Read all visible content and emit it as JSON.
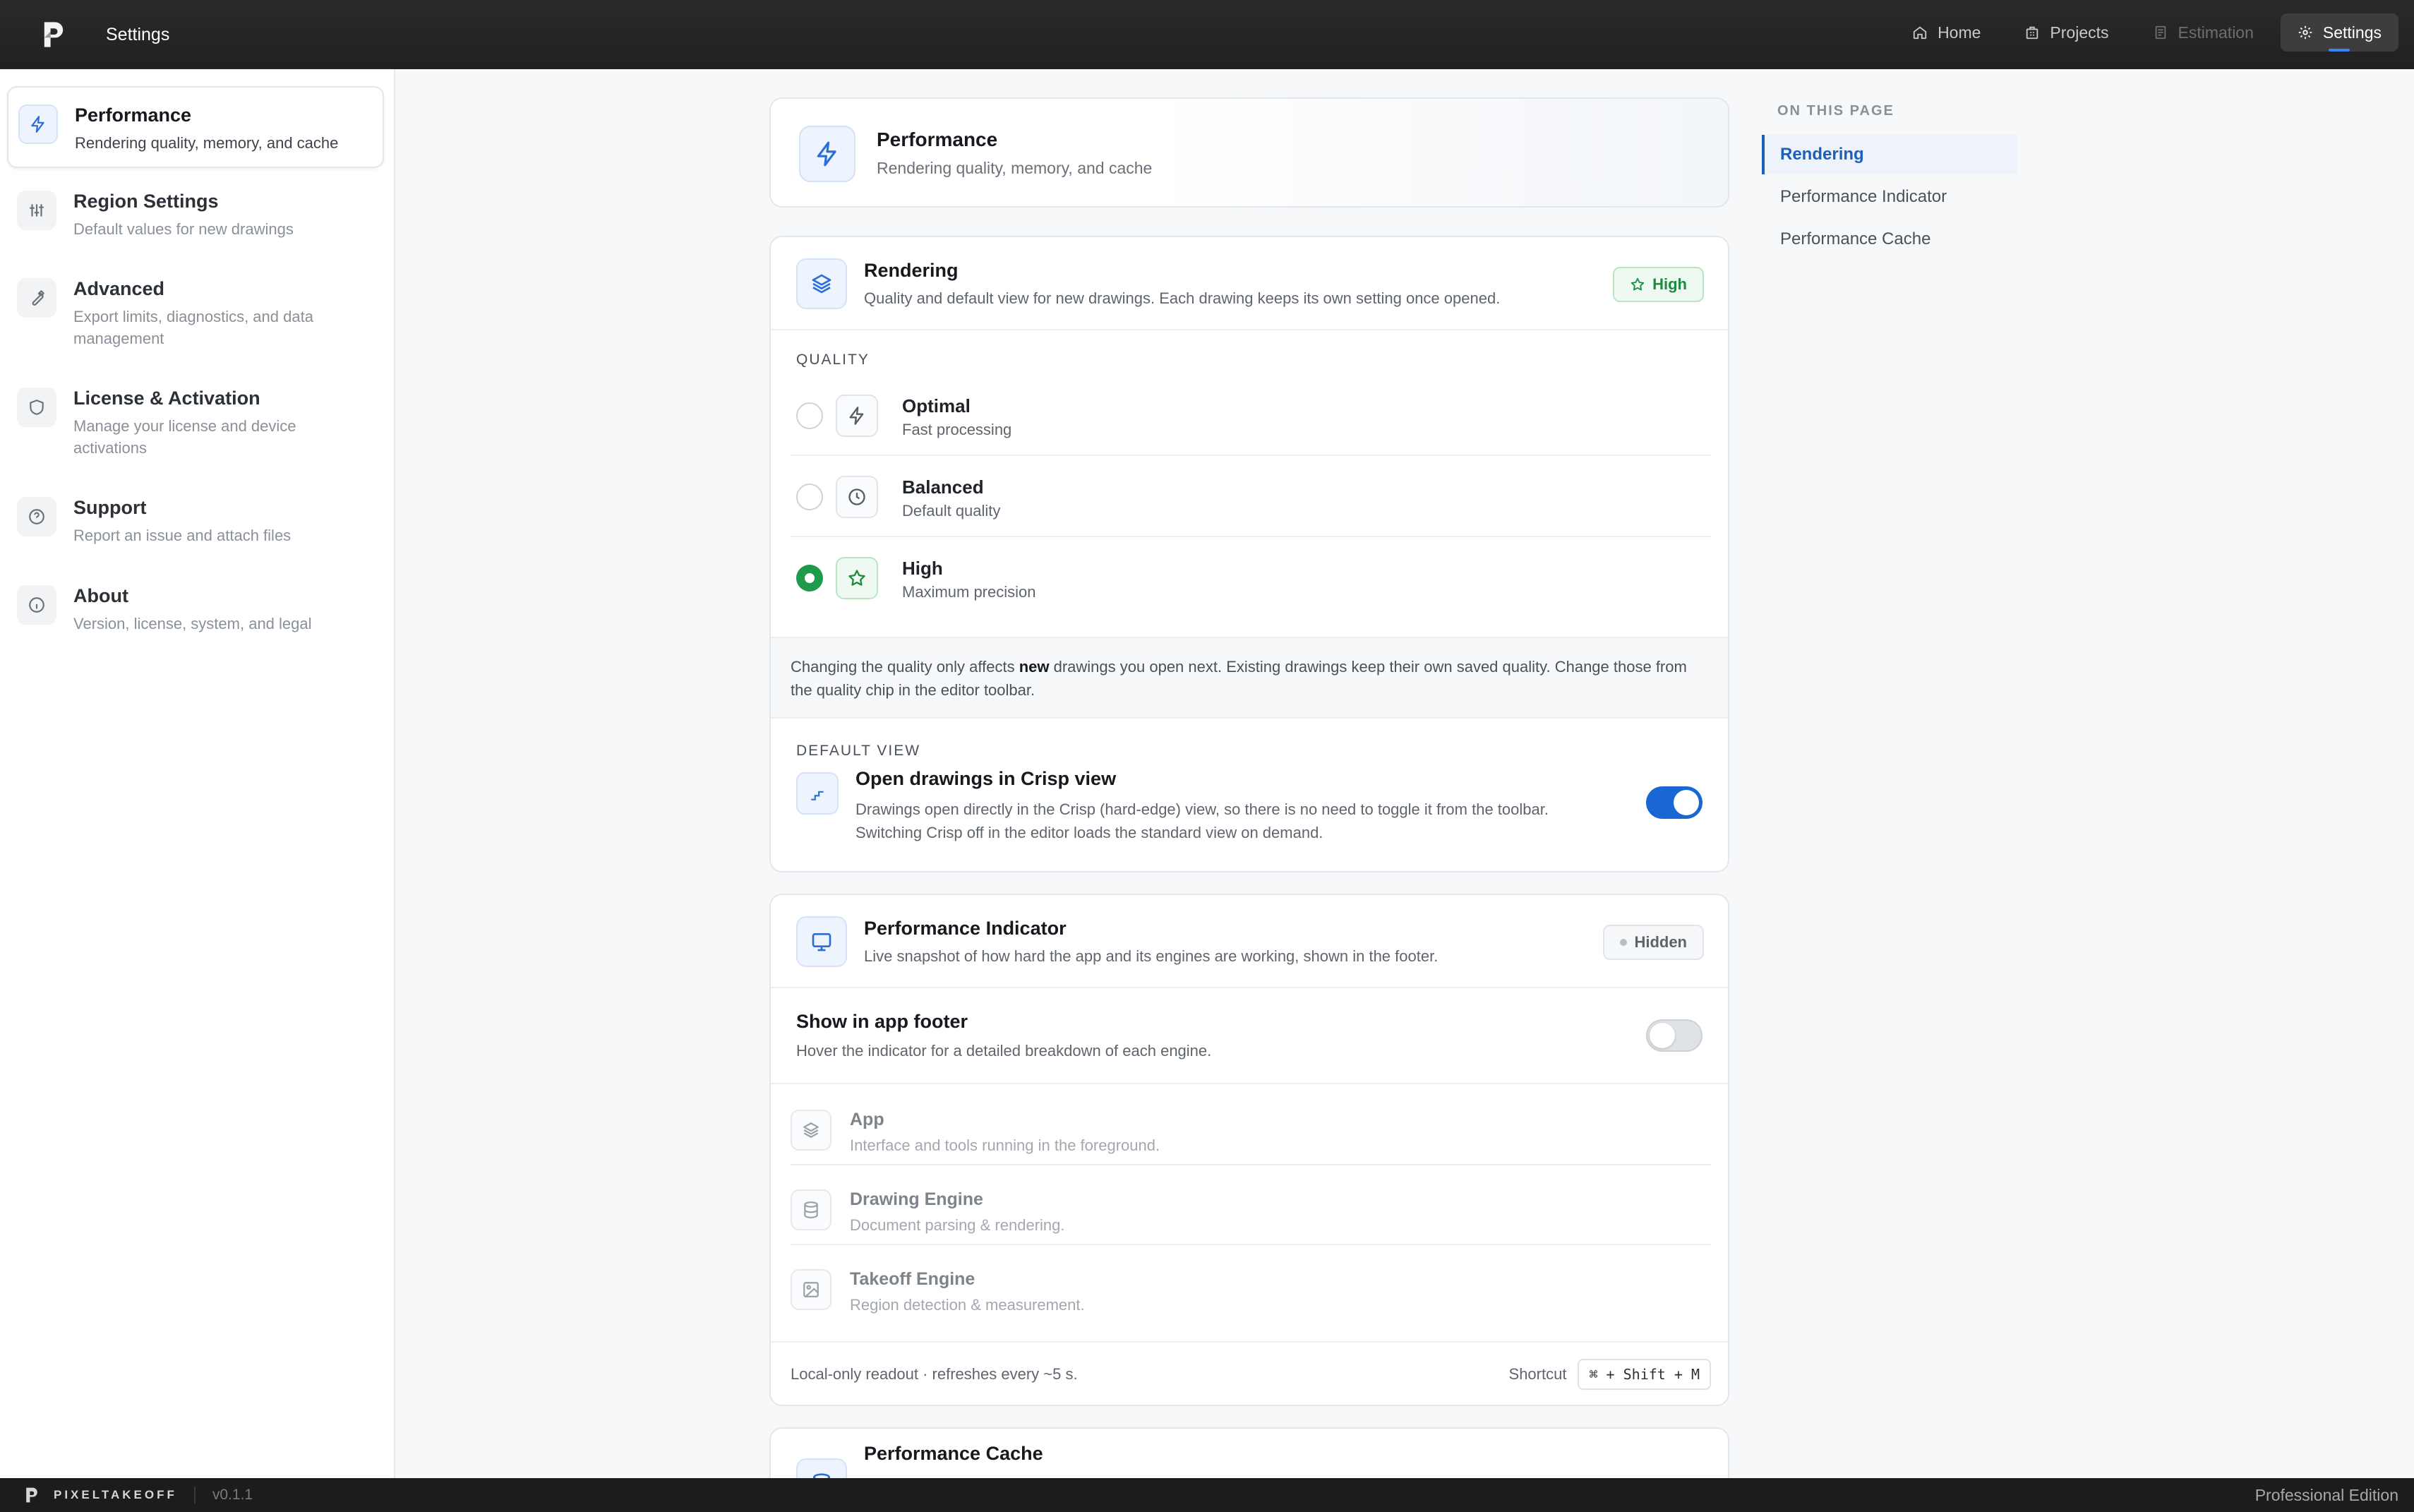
{
  "app": {
    "title": "Settings"
  },
  "topnav": [
    {
      "label": "Home",
      "icon": "home-icon",
      "state": "normal"
    },
    {
      "label": "Projects",
      "icon": "building-icon",
      "state": "normal"
    },
    {
      "label": "Estimation",
      "icon": "document-icon",
      "state": "disabled"
    },
    {
      "label": "Settings",
      "icon": "gear-icon",
      "state": "active"
    }
  ],
  "sidebar": {
    "items": [
      {
        "title": "Performance",
        "subtitle": "Rendering quality, memory, and cache",
        "icon": "bolt-icon",
        "active": true
      },
      {
        "title": "Region Settings",
        "subtitle": "Default values for new drawings",
        "icon": "sliders-icon"
      },
      {
        "title": "Advanced",
        "subtitle": "Export limits, diagnostics, and data management",
        "icon": "wrench-icon"
      },
      {
        "title": "License & Activation",
        "subtitle": "Manage your license and device activations",
        "icon": "shield-icon"
      },
      {
        "title": "Support",
        "subtitle": "Report an issue and attach files",
        "icon": "help-circle-icon"
      },
      {
        "title": "About",
        "subtitle": "Version, license, system, and legal",
        "icon": "info-icon"
      }
    ]
  },
  "hero": {
    "title": "Performance",
    "subtitle": "Rendering quality, memory, and cache"
  },
  "rendering": {
    "title": "Rendering",
    "subtitle": "Quality and default view for new drawings. Each drawing keeps its own setting once opened.",
    "badge": "High",
    "quality_label": "QUALITY",
    "options": [
      {
        "title": "Optimal",
        "subtitle": "Fast processing",
        "icon": "bolt-icon",
        "selected": false
      },
      {
        "title": "Balanced",
        "subtitle": "Default quality",
        "icon": "clock-icon",
        "selected": false
      },
      {
        "title": "High",
        "subtitle": "Maximum precision",
        "icon": "star-icon",
        "selected": true
      }
    ],
    "note_before": "Changing the quality only affects ",
    "note_bold": "new",
    "note_after": " drawings you open next. Existing drawings keep their own saved quality. Change those from the quality chip in the editor toolbar.",
    "default_view_label": "DEFAULT VIEW",
    "crisp_title": "Open drawings in Crisp view",
    "crisp_desc": "Drawings open directly in the Crisp (hard-edge) view, so there is no need to toggle it from the toolbar. Switching Crisp off in the editor loads the standard view on demand.",
    "crisp_enabled": true
  },
  "indicator": {
    "title": "Performance Indicator",
    "subtitle": "Live snapshot of how hard the app and its engines are working, shown in the footer.",
    "badge": "Hidden",
    "footer_title": "Show in app footer",
    "footer_desc": "Hover the indicator for a detailed breakdown of each engine.",
    "footer_enabled": false,
    "engines": [
      {
        "title": "App",
        "subtitle": "Interface and tools running in the foreground.",
        "icon": "layers-icon"
      },
      {
        "title": "Drawing Engine",
        "subtitle": "Document parsing & rendering.",
        "icon": "database-icon"
      },
      {
        "title": "Takeoff Engine",
        "subtitle": "Region detection & measurement.",
        "icon": "image-icon"
      }
    ],
    "readout": "Local-only readout · refreshes every ~5 s.",
    "shortcut_label": "Shortcut",
    "shortcut": "⌘ + Shift + M"
  },
  "cache": {
    "title": "Performance Cache"
  },
  "toc": {
    "heading": "ON THIS PAGE",
    "items": [
      {
        "label": "Rendering",
        "active": true
      },
      {
        "label": "Performance Indicator"
      },
      {
        "label": "Performance Cache"
      }
    ]
  },
  "statusbar": {
    "brand": "PIXELTAKEOFF",
    "version": "v0.1.1",
    "edition": "Professional Edition"
  },
  "colors": {
    "accent": "#1967d2",
    "success": "#1f9a4b",
    "topbar": "#222222"
  }
}
